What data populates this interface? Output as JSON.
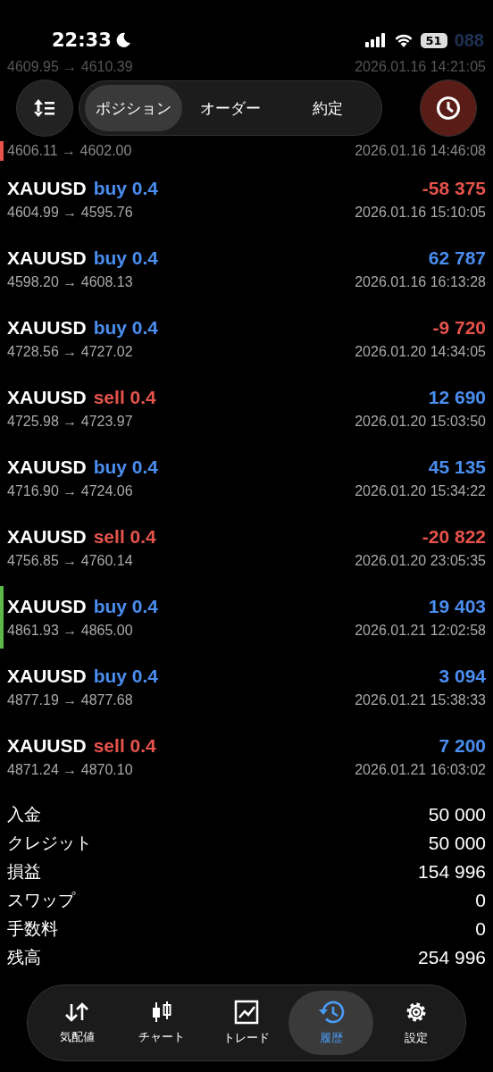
{
  "status_bar": {
    "time": "22:33",
    "battery": "51",
    "behind_text": "088"
  },
  "partial_rows": [
    {
      "prices": "4609.95 → 4610.39",
      "time": "2026.01.16 14:21:05"
    },
    {
      "prices": "4606.11 → 4602.00",
      "time": "2026.01.16 14:46:08",
      "color": "#e5534b"
    }
  ],
  "tabs": [
    {
      "label": "ポジション",
      "selected": true
    },
    {
      "label": "オーダー",
      "selected": false
    },
    {
      "label": "約定",
      "selected": false
    }
  ],
  "deals": [
    {
      "symbol": "XAUUSD",
      "side": "buy",
      "volume": "0.4",
      "profit": "-58 375",
      "prices": "4604.99 → 4595.76",
      "time": "2026.01.16 15:10:05"
    },
    {
      "symbol": "XAUUSD",
      "side": "buy",
      "volume": "0.4",
      "profit": "62 787",
      "prices": "4598.20 → 4608.13",
      "time": "2026.01.16 16:13:28"
    },
    {
      "symbol": "XAUUSD",
      "side": "buy",
      "volume": "0.4",
      "profit": "-9 720",
      "prices": "4728.56 → 4727.02",
      "time": "2026.01.20 14:34:05"
    },
    {
      "symbol": "XAUUSD",
      "side": "sell",
      "volume": "0.4",
      "profit": "12 690",
      "prices": "4725.98 → 4723.97",
      "time": "2026.01.20 15:03:50"
    },
    {
      "symbol": "XAUUSD",
      "side": "buy",
      "volume": "0.4",
      "profit": "45 135",
      "prices": "4716.90 → 4724.06",
      "time": "2026.01.20 15:34:22"
    },
    {
      "symbol": "XAUUSD",
      "side": "sell",
      "volume": "0.4",
      "profit": "-20 822",
      "prices": "4756.85 → 4760.14",
      "time": "2026.01.20 23:05:35"
    },
    {
      "symbol": "XAUUSD",
      "side": "buy",
      "volume": "0.4",
      "profit": "19 403",
      "prices": "4861.93 → 4865.00",
      "time": "2026.01.21 12:02:58",
      "color": "#5cb848"
    },
    {
      "symbol": "XAUUSD",
      "side": "buy",
      "volume": "0.4",
      "profit": "3 094",
      "prices": "4877.19 → 4877.68",
      "time": "2026.01.21 15:38:33"
    },
    {
      "symbol": "XAUUSD",
      "side": "sell",
      "volume": "0.4",
      "profit": "7 200",
      "prices": "4871.24 → 4870.10",
      "time": "2026.01.21 16:03:02"
    }
  ],
  "summary": [
    {
      "label": "入金",
      "value": "50 000"
    },
    {
      "label": "クレジット",
      "value": "50 000"
    },
    {
      "label": "損益",
      "value": "154 996"
    },
    {
      "label": "スワップ",
      "value": "0"
    },
    {
      "label": "手数料",
      "value": "0"
    },
    {
      "label": "残高",
      "value": "254 996"
    }
  ],
  "nav": [
    {
      "label": "気配値",
      "selected": false
    },
    {
      "label": "チャート",
      "selected": false
    },
    {
      "label": "トレード",
      "selected": false
    },
    {
      "label": "履歴",
      "selected": true
    },
    {
      "label": "設定",
      "selected": false
    }
  ]
}
